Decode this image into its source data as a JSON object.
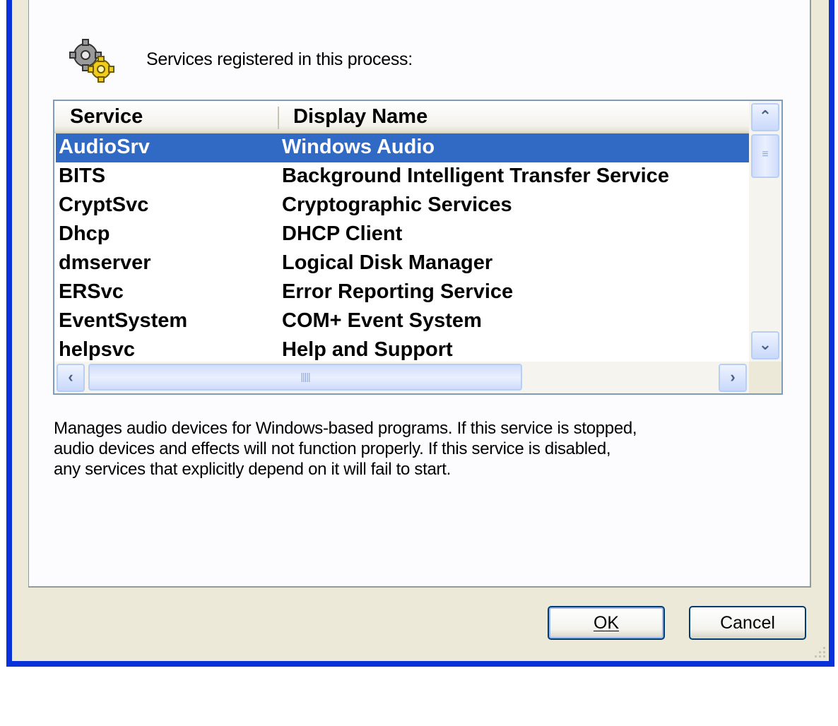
{
  "dialog": {
    "services_label": "Services registered in this process:",
    "description": "Manages audio devices for Windows-based programs. If this service is stopped, audio devices and effects will not function properly. If this service is disabled, any services that explicitly depend on it will fail to start.",
    "description_lines": [
      "Manages audio devices for Windows-based programs. If this service is stopped,",
      "audio devices and effects will not function properly. If this service is disabled,",
      "any services that explicitly depend on it will fail to start."
    ],
    "ok_label": "OK",
    "cancel_label": "Cancel"
  },
  "services_table": {
    "columns": [
      "Service",
      "Display Name"
    ],
    "selected_index": 0,
    "rows": [
      {
        "service": "AudioSrv",
        "display_name": "Windows Audio"
      },
      {
        "service": "BITS",
        "display_name": "Background Intelligent Transfer Service"
      },
      {
        "service": "CryptSvc",
        "display_name": "Cryptographic Services"
      },
      {
        "service": "Dhcp",
        "display_name": "DHCP Client"
      },
      {
        "service": "dmserver",
        "display_name": "Logical Disk Manager"
      },
      {
        "service": "ERSvc",
        "display_name": "Error Reporting Service"
      },
      {
        "service": "EventSystem",
        "display_name": "COM+ Event System"
      },
      {
        "service": "helpsvc",
        "display_name": "Help and Support"
      }
    ]
  },
  "icons": {
    "process": "gears-icon",
    "scroll_up": "chevron-up-icon",
    "scroll_down": "chevron-down-icon",
    "scroll_left": "chevron-left-icon",
    "scroll_right": "chevron-right-icon",
    "resize": "resize-grip-icon"
  },
  "colors": {
    "selection": "#316ac5",
    "window_border": "#0831d9",
    "dialog_background": "#ece9d8"
  }
}
